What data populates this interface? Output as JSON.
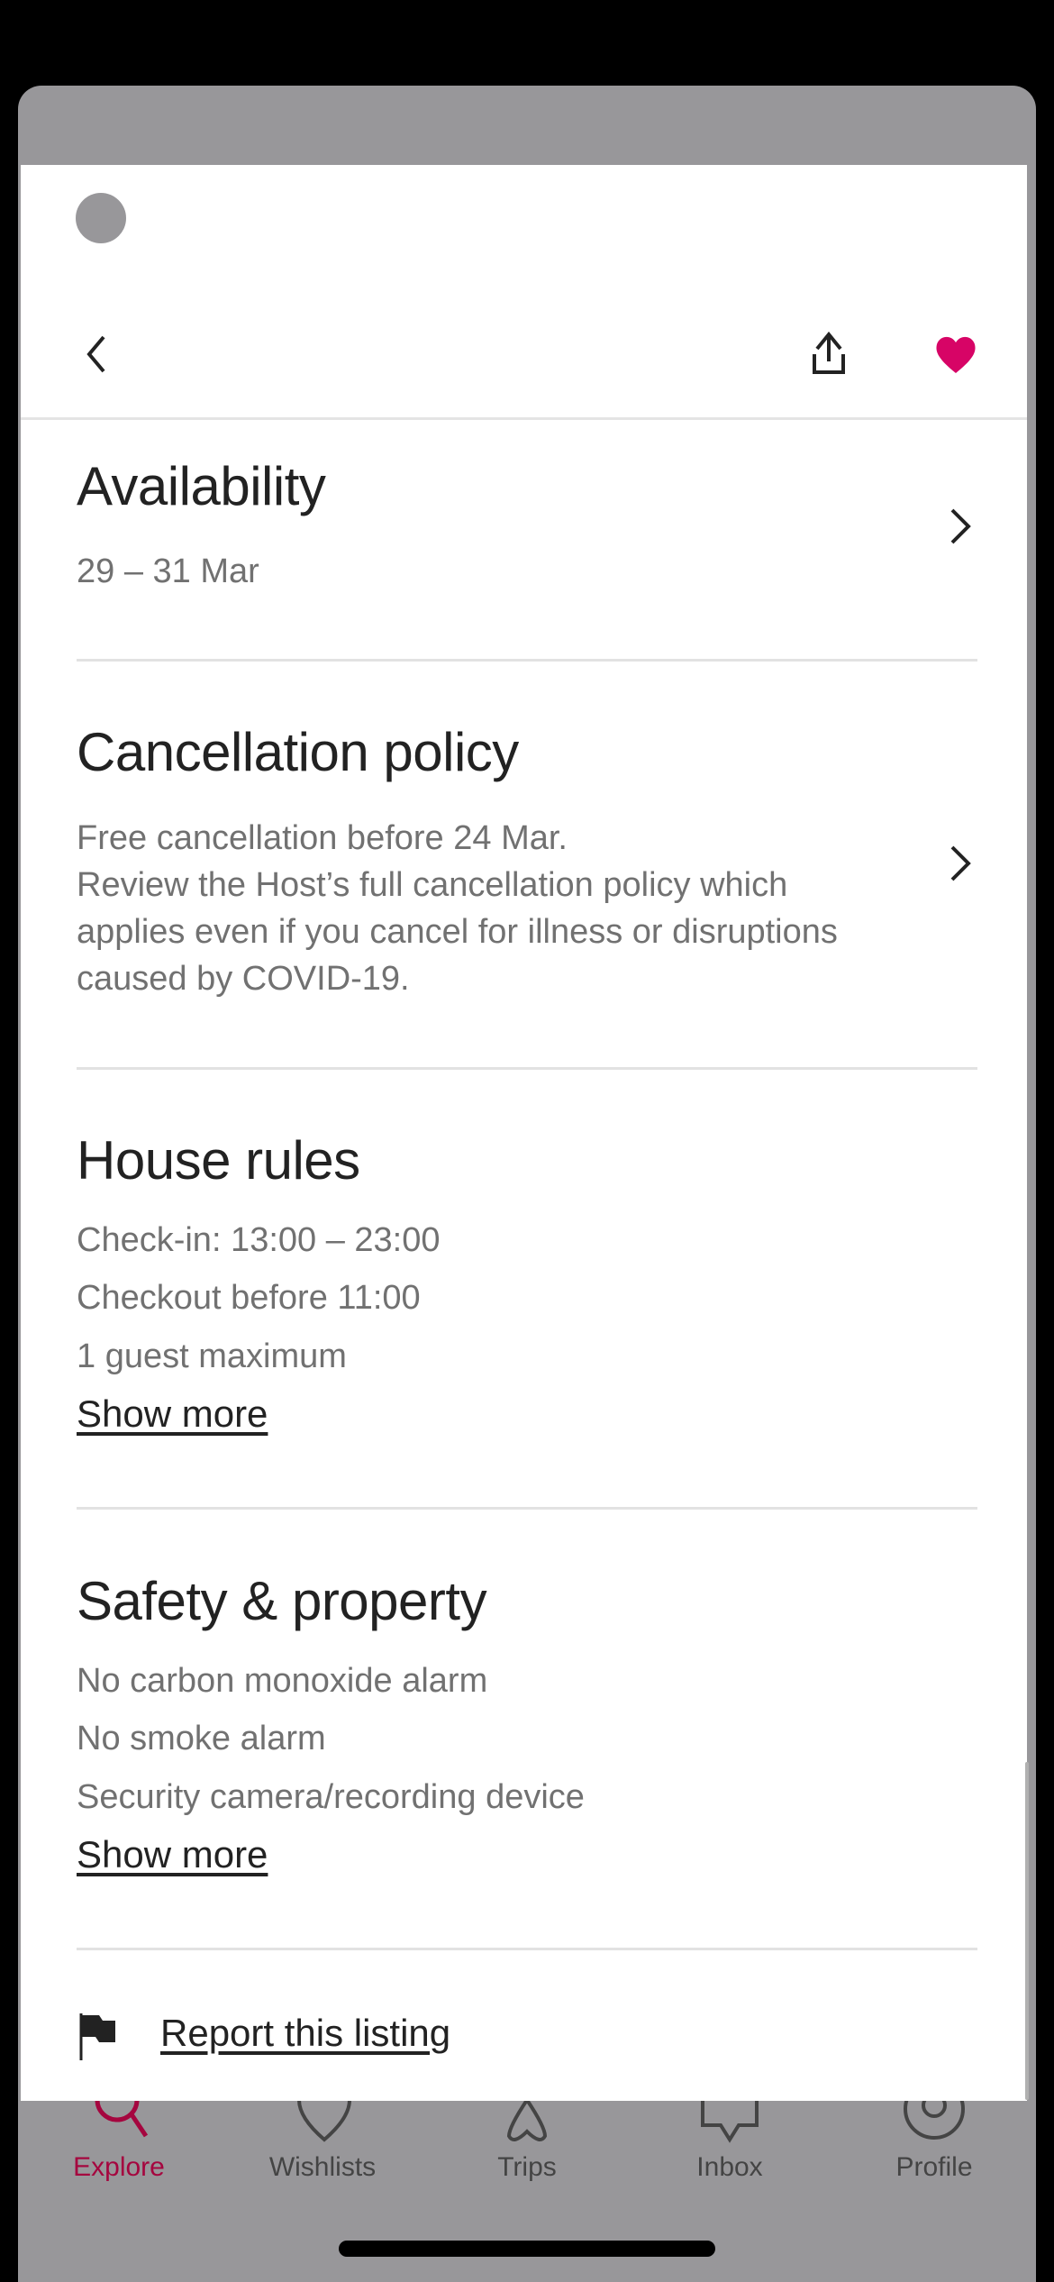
{
  "header": {
    "icons": [
      "back-chevron-icon",
      "share-icon",
      "heart-icon"
    ],
    "heart_color": "#d70466"
  },
  "sections": [
    {
      "title": "Availability",
      "lines": [
        "29 – 31 Mar"
      ]
    },
    {
      "title": "Cancellation policy",
      "lines": [
        "Free cancellation before 24 Mar.",
        "Review the Host’s full cancellation policy which",
        "applies even if you cancel for illness or disruptions",
        "caused by COVID-19."
      ]
    },
    {
      "title": "House rules",
      "lines": [
        "Check-in: 13:00 – 23:00",
        "Checkout before 11:00",
        "1 guest maximum"
      ],
      "show_more": "Show more"
    },
    {
      "title": "Safety & property",
      "lines": [
        "No carbon monoxide alarm",
        "No smoke alarm",
        "Security camera/recording device"
      ],
      "show_more": "Show more"
    }
  ],
  "report": {
    "label": "Report this listing",
    "icon": "flag-icon"
  },
  "tabbar": {
    "active_color": "#a5063f",
    "items": [
      {
        "label": "Explore",
        "icon": "search-icon"
      },
      {
        "label": "Wishlists",
        "icon": "heart-outline-icon"
      },
      {
        "label": "Trips",
        "icon": "airbnb-logo-icon"
      },
      {
        "label": "Inbox",
        "icon": "message-icon"
      },
      {
        "label": "Profile",
        "icon": "profile-icon"
      }
    ]
  }
}
